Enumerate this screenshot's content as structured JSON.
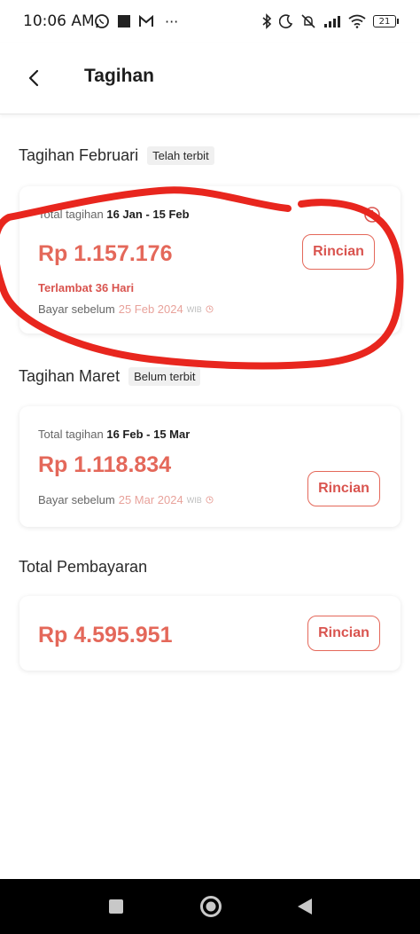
{
  "status_bar": {
    "time": "10:06 AM",
    "more": "···",
    "battery": "21"
  },
  "header": {
    "title": "Tagihan"
  },
  "sections": [
    {
      "title": "Tagihan Februari",
      "tag": "Telah terbit",
      "card": {
        "period_prefix": "Total tagihan",
        "period": "16 Jan - 15 Feb",
        "amount": "Rp 1.157.176",
        "late": "Terlambat 36 Hari",
        "due_prefix": "Bayar sebelum",
        "due_date": "25 Feb 2024",
        "tz": "WIB",
        "button": "Rincian"
      }
    },
    {
      "title": "Tagihan Maret",
      "tag": "Belum terbit",
      "card": {
        "period_prefix": "Total tagihan",
        "period": "16 Feb - 15 Mar",
        "amount": "Rp 1.118.834",
        "due_prefix": "Bayar sebelum",
        "due_date": "25 Mar 2024",
        "tz": "WIB",
        "button": "Rincian"
      }
    },
    {
      "title": "Total Pembayaran",
      "card": {
        "amount": "Rp 4.595.951",
        "button": "Rincian"
      }
    }
  ],
  "colors": {
    "accent": "#e4685a",
    "annotation": "#e8261e",
    "nav_bg": "#000000"
  },
  "icons": {
    "back": "chevron-left-icon",
    "info": "info-icon",
    "clock": "clock-icon",
    "nav_recents": "square-icon",
    "nav_home": "circle-icon",
    "nav_back": "triangle-icon"
  }
}
